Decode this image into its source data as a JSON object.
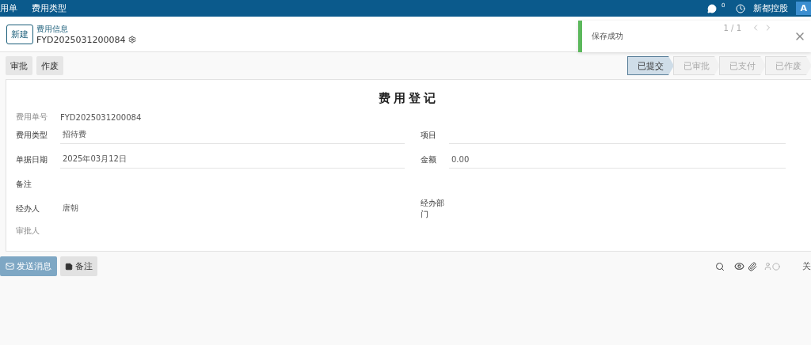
{
  "topbar": {
    "menu": [
      "用单",
      "费用类型"
    ],
    "chat_count": "0",
    "company": "新都控股",
    "avatar": "A"
  },
  "control": {
    "new_button": "新建",
    "breadcrumb": "费用信息",
    "record": "FYD2025031200084",
    "pager": "1 / 1"
  },
  "toast": {
    "message": "保存成功"
  },
  "actions": [
    "审批",
    "作废"
  ],
  "stages": [
    {
      "label": "已提交",
      "selected": true
    },
    {
      "label": "已审批",
      "selected": false
    },
    {
      "label": "已支付",
      "selected": false
    },
    {
      "label": "已作废",
      "selected": false
    }
  ],
  "sheet": {
    "title": "费用登记",
    "number_label": "费用单号",
    "number": "FYD2025031200084",
    "left": [
      {
        "label": "费用类型",
        "value": "招待费",
        "underline": true
      },
      {
        "label": "单据日期",
        "value": "2025年03月12日",
        "underline": true
      },
      {
        "label": "备注",
        "underline": false
      },
      {
        "label": "经办人",
        "value": "唐朝",
        "underline": false
      }
    ],
    "right": [
      {
        "label": "项目",
        "underline": true
      },
      {
        "label": "金额",
        "value": "0.00",
        "underline": true
      },
      {
        "underline": false
      },
      {
        "label": "经办部门",
        "underline": false
      }
    ],
    "approver_label": "审批人"
  },
  "chatter": {
    "send": "发送消息",
    "note": "备注",
    "follow": "关"
  }
}
